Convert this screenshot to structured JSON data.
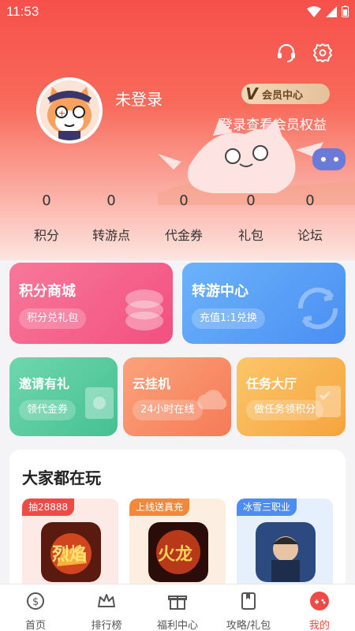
{
  "status_bar": {
    "time": "11:53"
  },
  "profile": {
    "username": "未登录",
    "vip_label": "会员中心",
    "vip_letter": "V",
    "vip_link": "登录查看会员权益"
  },
  "stats": [
    {
      "value": "0",
      "label": "积分"
    },
    {
      "value": "0",
      "label": "转游点"
    },
    {
      "value": "0",
      "label": "代金券"
    },
    {
      "value": "0",
      "label": "礼包"
    },
    {
      "value": "0",
      "label": "论坛"
    }
  ],
  "cards": {
    "points_mall": {
      "title": "积分商城",
      "subtitle": "积分兑礼包",
      "color": "#f4618a"
    },
    "transfer": {
      "title": "转游中心",
      "subtitle": "充值1:1兑换",
      "color": "#5aa2f5"
    },
    "invite": {
      "title": "邀请有礼",
      "subtitle": "领代金券",
      "color": "#4ec79a"
    },
    "cloud": {
      "title": "云挂机",
      "subtitle": "24小时在线",
      "color": "#f58a66"
    },
    "tasks": {
      "title": "任务大厅",
      "subtitle": "做任务领积分",
      "color": "#f7b04c"
    }
  },
  "playing": {
    "title": "大家都在玩",
    "games": [
      {
        "tag": "抽28888",
        "tag_color": "#f04a46"
      },
      {
        "tag": "上线送真充",
        "tag_color": "#f08a3a"
      },
      {
        "tag": "冰雪三职业",
        "tag_color": "#4d8cf0"
      }
    ]
  },
  "tabbar": [
    {
      "label": "首页",
      "icon": "home-coin-icon"
    },
    {
      "label": "排行榜",
      "icon": "crown-icon"
    },
    {
      "label": "福利中心",
      "icon": "gift-icon"
    },
    {
      "label": "攻略/礼包",
      "icon": "book-icon"
    },
    {
      "label": "我的",
      "icon": "profile-game-icon",
      "active": true
    }
  ]
}
